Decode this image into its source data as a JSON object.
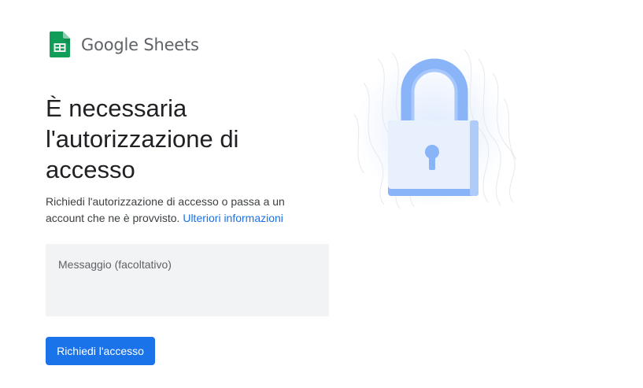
{
  "app": {
    "name": "Google Sheets",
    "icon": "google-sheets-icon"
  },
  "main": {
    "title": "È necessaria l'autorizzazione di accesso",
    "description": "Richiedi l'autorizzazione di accesso o passa a un account che ne è provvisto.",
    "learn_more_link": "Ulteriori informazioni",
    "message_placeholder": "Messaggio (facoltativo)",
    "message_value": "",
    "request_button": "Richiedi l'accesso"
  },
  "illustration": {
    "icon": "padlock-icon"
  },
  "colors": {
    "accent": "#1a73e8",
    "sheets_green": "#0f9d58",
    "field_bg": "#f1f3f4",
    "lock_body": "#e8f0fe",
    "lock_shackle": "#8ab4f8"
  }
}
